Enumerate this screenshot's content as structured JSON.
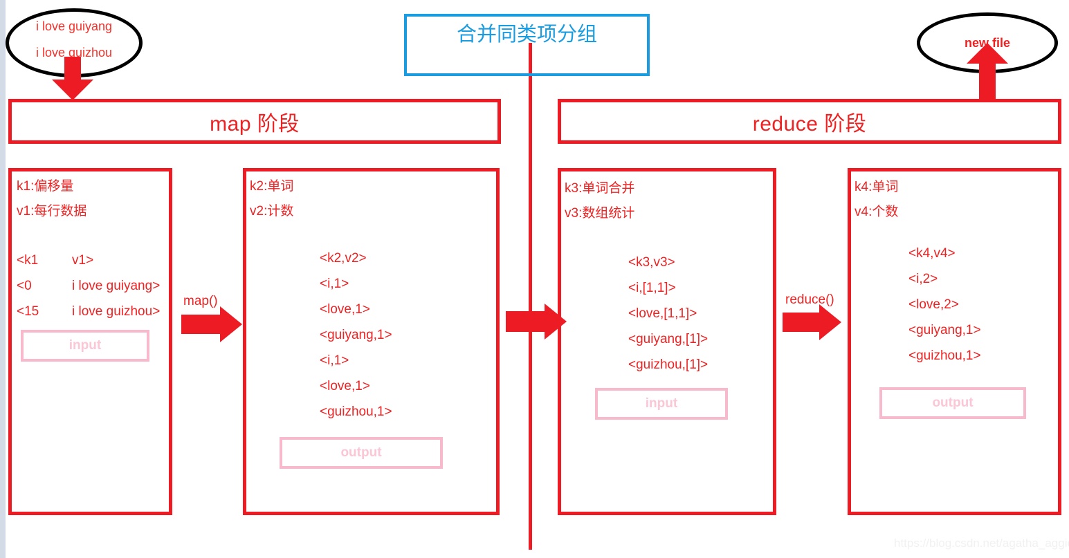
{
  "diagram": {
    "title_box": {
      "label": "合并同类项分组",
      "color": "#1a9ce0"
    },
    "source_ellipse": {
      "name": "source-file-ellipse",
      "lines": [
        "i love guiyang",
        "i love guizhou"
      ]
    },
    "result_ellipse": {
      "name": "new-file-ellipse",
      "label": "new file"
    },
    "stages": [
      {
        "id": "map",
        "label": "map 阶段"
      },
      {
        "id": "reduce",
        "label": "reduce 阶段"
      }
    ],
    "arrows": [
      {
        "id": "source-to-map",
        "label": ""
      },
      {
        "id": "map-function",
        "label": "map()"
      },
      {
        "id": "shuffle",
        "label": ""
      },
      {
        "id": "reduce-function",
        "label": "reduce()"
      },
      {
        "id": "reduce-to-newfile",
        "label": ""
      }
    ],
    "panels": [
      {
        "id": "panel-k1v1",
        "key_label": "k1:偏移量",
        "value_label": "v1:每行数据",
        "pairs_header": {
          "k": "<k1",
          "v": "v1>"
        },
        "pairs": [
          {
            "k": "<0",
            "v": "i love guiyang>"
          },
          {
            "k": "<15",
            "v": "i love guizhou>"
          }
        ],
        "io": {
          "label": "input",
          "type": "input"
        }
      },
      {
        "id": "panel-k2v2",
        "key_label": "k2:单词",
        "value_label": "v2:计数",
        "pairs_header": "<k2,v2>",
        "pairs": [
          "<i,1>",
          "<love,1>",
          "<guiyang,1>",
          "<i,1>",
          "<love,1>",
          "<guizhou,1>"
        ],
        "io": {
          "label": "output",
          "type": "output"
        }
      },
      {
        "id": "panel-k3v3",
        "key_label": "k3:单词合并",
        "value_label": "v3:数组统计",
        "pairs_header": "<k3,v3>",
        "pairs": [
          "<i,[1,1]>",
          "<love,[1,1]>",
          "<guiyang,[1]>",
          "<guizhou,[1]>"
        ],
        "io": {
          "label": "input",
          "type": "input"
        }
      },
      {
        "id": "panel-k4v4",
        "key_label": "k4:单词",
        "value_label": "v4:个数",
        "pairs_header": "<k4,v4>",
        "pairs": [
          "<i,2>",
          "<love,2>",
          "<guiyang,1>",
          "<guizhou,1>"
        ],
        "io": {
          "label": "output",
          "type": "output"
        }
      }
    ],
    "watermark": "https://blog.csdn.net/agatha_aggie"
  }
}
